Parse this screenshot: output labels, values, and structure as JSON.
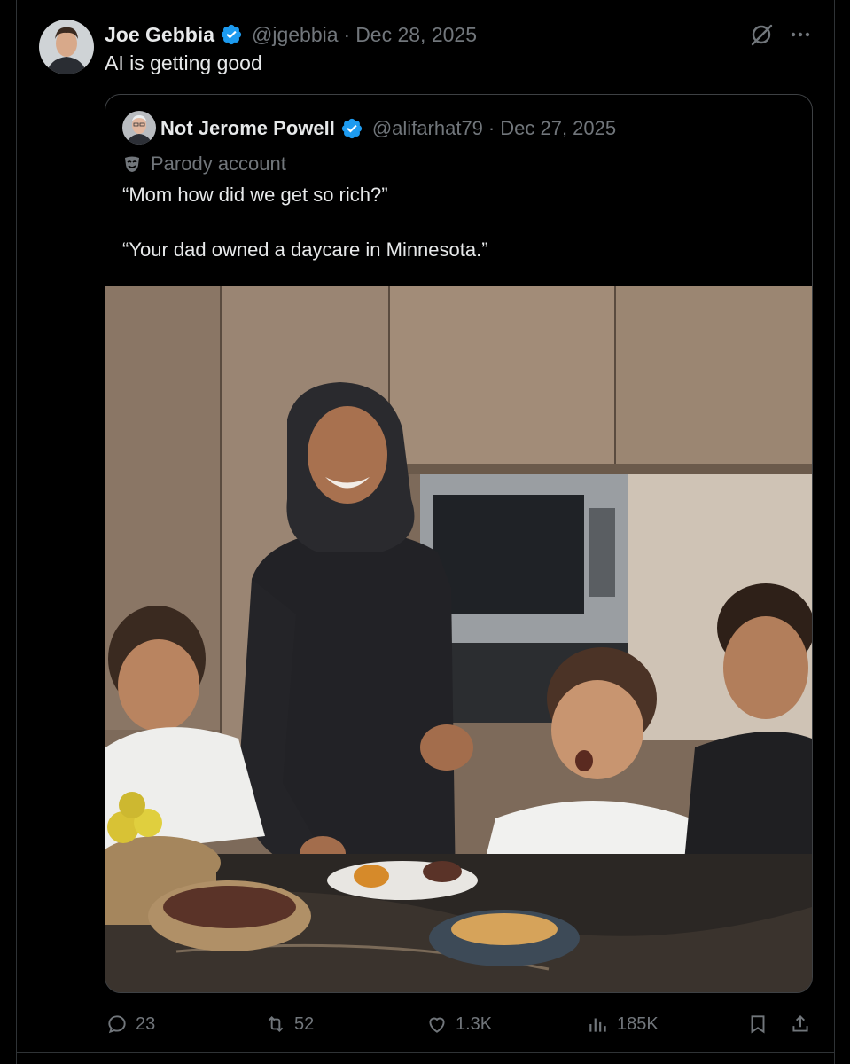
{
  "tweet": {
    "author_name": "Joe Gebbia",
    "handle": "@jgebbia",
    "separator": "·",
    "date": "Dec 28, 2025",
    "text": "AI is getting good"
  },
  "quote": {
    "author_name": "Not Jerome Powell",
    "handle": "@alifarhat79",
    "separator": "·",
    "date": "Dec 27, 2025",
    "parody_label": "Parody account",
    "line1": "“Mom how did we get so rich?”",
    "line2": "“Your dad owned a daycare in Minnesota.”"
  },
  "actions": {
    "replies": "23",
    "reposts": "52",
    "likes": "1.3K",
    "views": "185K"
  },
  "icons": {
    "verified": "verified-badge-icon",
    "grok": "grok-icon",
    "more": "more-icon",
    "parody": "parody-mask-icon",
    "reply": "reply-icon",
    "repost": "repost-icon",
    "like": "like-icon",
    "views": "views-icon",
    "bookmark": "bookmark-icon",
    "share": "share-icon"
  },
  "colors": {
    "background": "#000000",
    "text": "#e7e9ea",
    "muted": "#71767b",
    "verified": "#1d9bf0",
    "border": "#2f3336"
  }
}
